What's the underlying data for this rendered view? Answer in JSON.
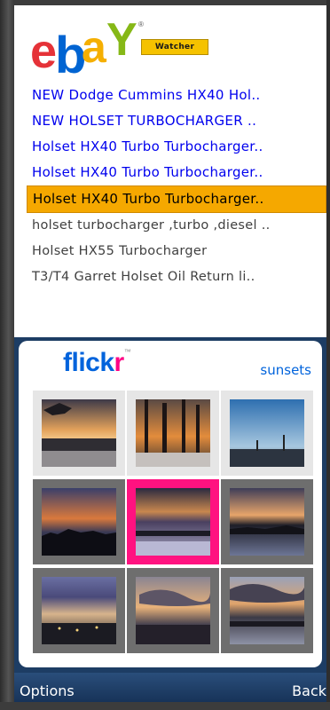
{
  "ebay": {
    "badge": "Watcher",
    "items": [
      {
        "title": "NEW Dodge Cummins HX40 Hol..",
        "state": "new"
      },
      {
        "title": "NEW HOLSET TURBOCHARGER ..",
        "state": "new"
      },
      {
        "title": "Holset HX40 Turbo Turbocharger..",
        "state": "new"
      },
      {
        "title": "Holset HX40 Turbo Turbocharger..",
        "state": "new"
      },
      {
        "title": "Holset HX40 Turbo Turbocharger..",
        "state": "selected"
      },
      {
        "title": "holset turbocharger ,turbo ,diesel ..",
        "state": "seen"
      },
      {
        "title": "Holset HX55 Turbocharger",
        "state": "seen"
      },
      {
        "title": "T3/T4 Garret Holset Oil Return li..",
        "state": "seen"
      }
    ],
    "colors": {
      "new": "#0000ee",
      "selected_bg": "#f5a800"
    }
  },
  "flickr": {
    "logo_a": "flick",
    "logo_b": "r",
    "tag": "sunsets",
    "photos": [
      {
        "name": "photo-1",
        "tile": "light",
        "scene": "dusk-water-tree"
      },
      {
        "name": "photo-2",
        "tile": "light",
        "scene": "trees-sunset"
      },
      {
        "name": "photo-3",
        "tile": "light",
        "scene": "blue-sky-harbor"
      },
      {
        "name": "photo-4",
        "tile": "dark",
        "scene": "city-silhouette"
      },
      {
        "name": "photo-5",
        "tile": "selected",
        "scene": "purple-horizon"
      },
      {
        "name": "photo-6",
        "tile": "dark",
        "scene": "orange-horizon"
      },
      {
        "name": "photo-7",
        "tile": "dark",
        "scene": "violet-lights"
      },
      {
        "name": "photo-8",
        "tile": "dark",
        "scene": "clouds-town"
      },
      {
        "name": "photo-9",
        "tile": "dark",
        "scene": "clouds-water"
      }
    ]
  },
  "softkeys": {
    "left": "Options",
    "right": "Back"
  }
}
